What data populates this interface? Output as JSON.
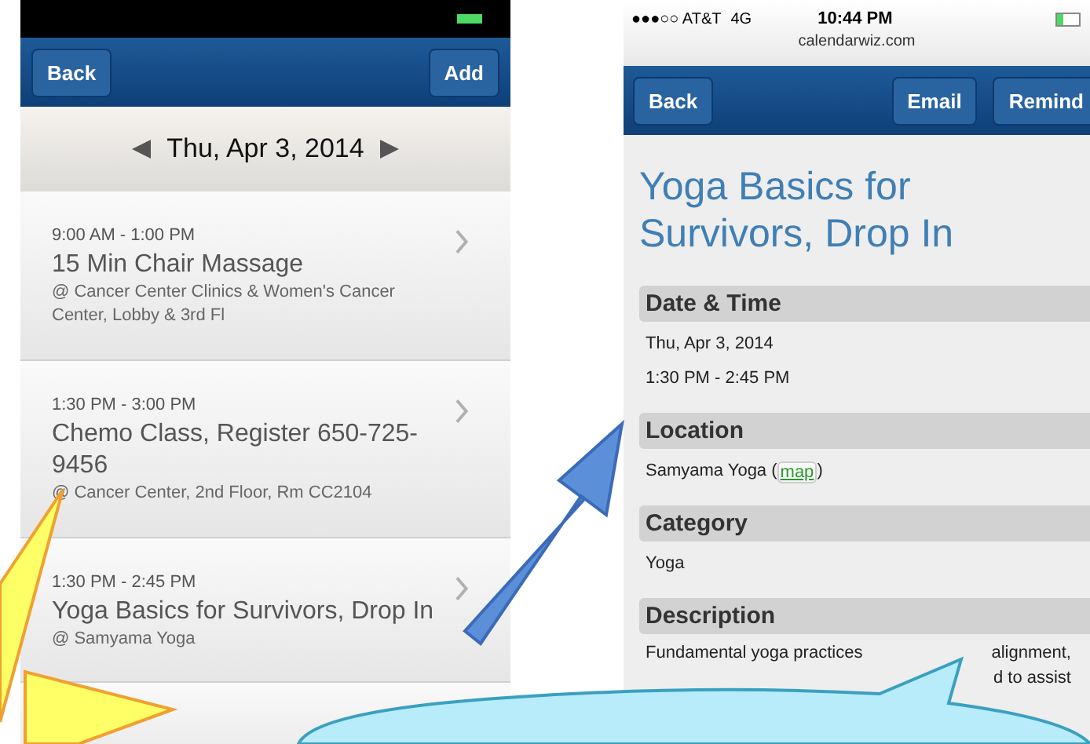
{
  "list_screen": {
    "nav": {
      "back": "Back",
      "add": "Add"
    },
    "date": "Thu, Apr 3, 2014",
    "events": [
      {
        "time": "9:00 AM - 1:00 PM",
        "title": "15 Min Chair Massage",
        "location": "@ Cancer Center Clinics & Women's Cancer Center, Lobby & 3rd Fl"
      },
      {
        "time": "1:30 PM - 3:00 PM",
        "title": "Chemo Class, Register 650-725-9456",
        "location": "@ Cancer Center, 2nd Floor, Rm CC2104"
      },
      {
        "time": "1:30 PM - 2:45 PM",
        "title": "Yoga Basics for Survivors, Drop In",
        "location": "@ Samyama Yoga"
      }
    ]
  },
  "detail_screen": {
    "status_bar": {
      "carrier": "●●●○○ AT&T",
      "network": "4G",
      "time": "10:44 PM",
      "url": "calendarwiz.com"
    },
    "nav": {
      "back": "Back",
      "email": "Email",
      "remind": "Remind"
    },
    "title": "Yoga Basics for Survivors, Drop In",
    "sections": [
      {
        "heading": "Date & Time",
        "lines": [
          "Thu, Apr 3, 2014",
          "1:30 PM - 2:45 PM"
        ]
      },
      {
        "heading": "Location",
        "text": "Samyama Yoga (",
        "link": "map",
        "after": ")"
      },
      {
        "heading": "Category",
        "lines": [
          "Yoga"
        ]
      },
      {
        "heading": "Description",
        "fragments": [
          "Fundamental yoga practices",
          "alignment,",
          "d to assist"
        ]
      }
    ]
  }
}
